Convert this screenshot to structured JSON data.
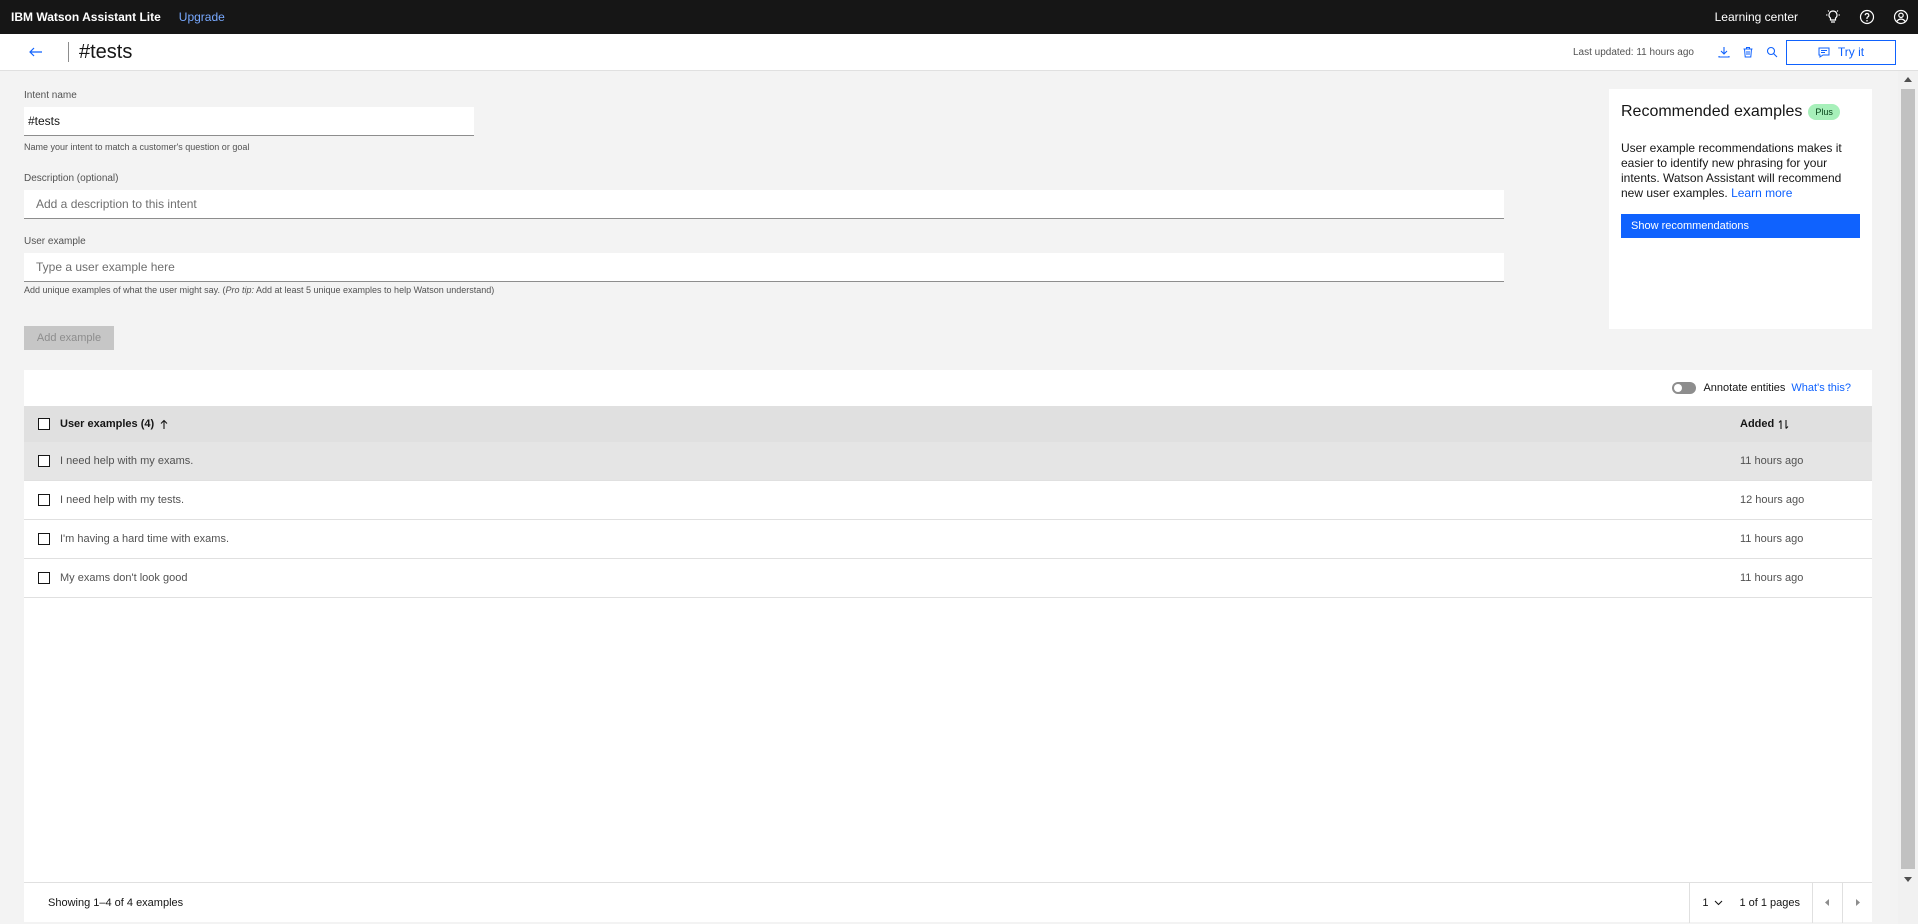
{
  "topbar": {
    "brand": "IBM Watson Assistant Lite",
    "upgrade": "Upgrade",
    "learning_center": "Learning center",
    "icons": [
      "idea-icon",
      "help-icon",
      "user-icon"
    ]
  },
  "header": {
    "title": "#tests",
    "last_updated": "Last updated: 11 hours ago",
    "try_it": "Try it"
  },
  "form": {
    "intent_name_label": "Intent name",
    "intent_name_value": "#tests",
    "intent_name_helper": "Name your intent to match a customer's question or goal",
    "description_label": "Description (optional)",
    "description_placeholder": "Add a description to this intent",
    "user_example_label": "User example",
    "user_example_placeholder": "Type a user example here",
    "user_example_helper_pre": "Add unique examples of what the user might say. (",
    "user_example_helper_em": "Pro tip:",
    "user_example_helper_post": " Add at least 5 unique examples to help Watson understand)",
    "add_example": "Add example"
  },
  "recommended": {
    "title": "Recommended examples",
    "badge": "Plus",
    "body": "User example recommendations makes it easier to identify new phrasing for your intents. Watson Assistant will recommend new user examples. ",
    "learn_more": "Learn more",
    "button": "Show recommendations"
  },
  "table": {
    "annotate_label": "Annotate entities",
    "whats_this": "What's this?",
    "col_examples": "User examples (4)",
    "col_added": "Added",
    "rows": [
      {
        "text": "I need help with my exams.",
        "added": "11 hours ago"
      },
      {
        "text": "I need help with my tests.",
        "added": "12 hours ago"
      },
      {
        "text": "I'm having a hard time with exams.",
        "added": "11 hours ago"
      },
      {
        "text": "My exams don't look good",
        "added": "11 hours ago"
      }
    ],
    "showing": "Showing 1–4 of 4 examples",
    "page": "1",
    "page_of": "1 of 1 pages"
  }
}
